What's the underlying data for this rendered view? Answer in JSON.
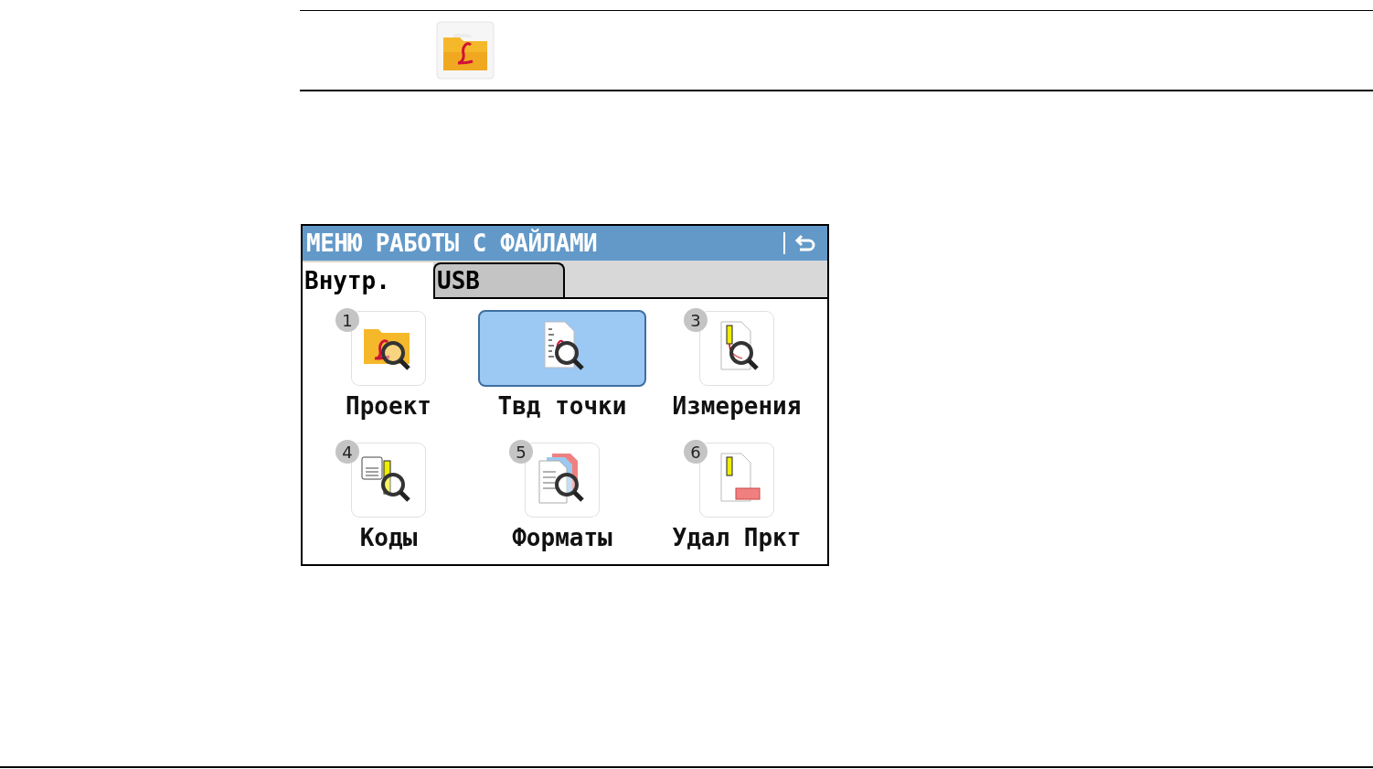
{
  "screen": {
    "title": "МЕНЮ РАБОТЫ С ФАЙЛАМИ",
    "tabs": [
      {
        "label": "Внутр.",
        "selected": true
      },
      {
        "label": "USB",
        "selected": false
      }
    ],
    "items": [
      {
        "number": "1",
        "label": "Проект",
        "kind": "folder",
        "selected": false
      },
      {
        "label": "Твд точки",
        "kind": "points",
        "selected": true
      },
      {
        "number": "3",
        "label": "Измерения",
        "kind": "measurements",
        "selected": false
      },
      {
        "number": "4",
        "label": "Коды",
        "kind": "codes",
        "selected": false
      },
      {
        "number": "5",
        "label": "Форматы",
        "kind": "formats",
        "selected": false
      },
      {
        "number": "6",
        "label": "Удал Пркт",
        "kind": "delete",
        "selected": false
      }
    ]
  }
}
